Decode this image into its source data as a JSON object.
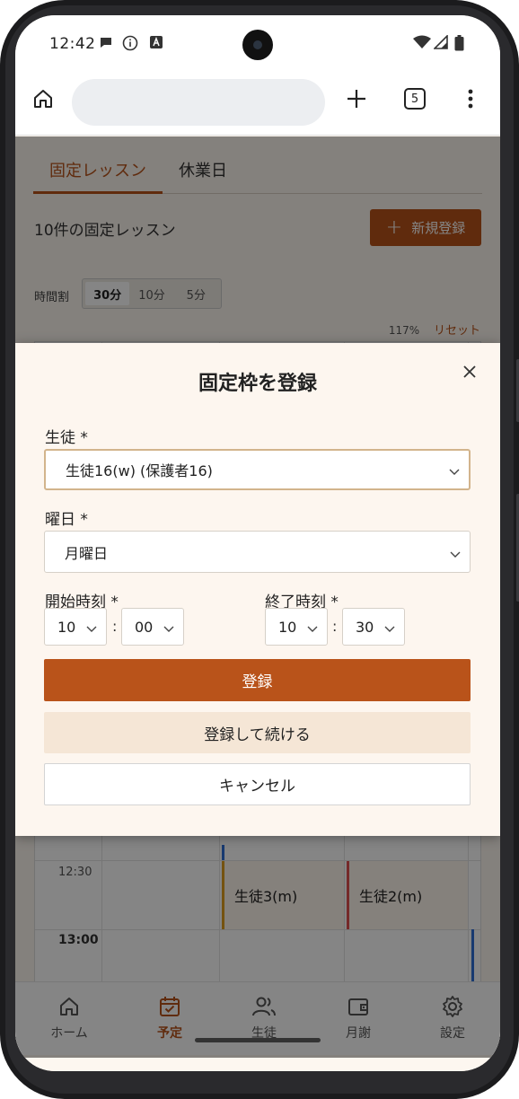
{
  "status_bar": {
    "time": "12:42",
    "icons": [
      "chat-bubble-icon",
      "info-icon",
      "text-a-icon",
      "wifi-icon",
      "signal-icon",
      "battery-icon"
    ]
  },
  "browser": {
    "tab_count": "5",
    "icons": [
      "home-icon",
      "plus-icon",
      "more-vert-icon"
    ]
  },
  "page": {
    "tabs": [
      {
        "label": "固定レッスン",
        "active": true
      },
      {
        "label": "休業日",
        "active": false
      }
    ],
    "count_text": "10件の固定レッスン",
    "new_button": "新規登録",
    "timeslot_label": "時間割",
    "timeslot_options": [
      "30分",
      "10分",
      "5分"
    ],
    "timeslot_selected": "30分",
    "zoom": "117%",
    "reset": "リセット",
    "schedule": {
      "times": [
        "12:30",
        "13:00"
      ],
      "lessons": [
        {
          "name": "生徒3(m)",
          "bar_color": "#e0a020"
        },
        {
          "name": "生徒2(m)",
          "bar_color": "#e05050"
        }
      ]
    }
  },
  "modal": {
    "title": "固定枠を登録",
    "student_label": "生徒 *",
    "student_value": "生徒16(w) (保護者16)",
    "weekday_label": "曜日 *",
    "weekday_value": "月曜日",
    "start_label": "開始時刻 *",
    "start_hour": "10",
    "start_minute": "00",
    "end_label": "終了時刻 *",
    "end_hour": "10",
    "end_minute": "30",
    "colon": ":",
    "register_button": "登録",
    "register_continue_button": "登録して続ける",
    "cancel_button": "キャンセル"
  },
  "bottom_nav": [
    {
      "label": "ホーム",
      "icon": "home-icon",
      "active": false
    },
    {
      "label": "予定",
      "icon": "calendar-check-icon",
      "active": true
    },
    {
      "label": "生徒",
      "icon": "people-icon",
      "active": false
    },
    {
      "label": "月謝",
      "icon": "wallet-icon",
      "active": false
    },
    {
      "label": "設定",
      "icon": "gear-icon",
      "active": false
    }
  ],
  "colors": {
    "accent": "#b9531a",
    "accent_light": "#f5e6d6",
    "background": "#fdf6ef"
  }
}
